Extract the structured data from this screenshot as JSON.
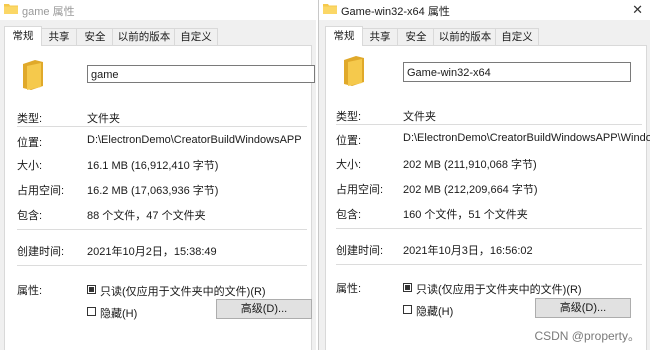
{
  "left": {
    "title": "game 属性",
    "tabs": [
      "常规",
      "共享",
      "安全",
      "以前的版本",
      "自定义"
    ],
    "name_value": "game",
    "type_label": "类型:",
    "type_value": "文件夹",
    "location_label": "位置:",
    "location_value": "D:\\ElectronDemo\\CreatorBuildWindowsAPP",
    "size_label": "大小:",
    "size_value": "16.1 MB (16,912,410 字节)",
    "disk_label": "占用空间:",
    "disk_value": "16.2 MB (17,063,936 字节)",
    "contains_label": "包含:",
    "contains_value": "88 个文件，47 个文件夹",
    "created_label": "创建时间:",
    "created_value": "2021年10月2日，15:38:49",
    "attr_label": "属性:",
    "readonly_label": "只读(仅应用于文件夹中的文件)(R)",
    "readonly_checked": true,
    "hidden_label": "隐藏(H)",
    "hidden_checked": false,
    "advanced_button": "高级(D)..."
  },
  "right": {
    "title": "Game-win32-x64 属性",
    "tabs": [
      "常规",
      "共享",
      "安全",
      "以前的版本",
      "自定义"
    ],
    "name_value": "Game-win32-x64",
    "type_label": "类型:",
    "type_value": "文件夹",
    "location_label": "位置:",
    "location_value": "D:\\ElectronDemo\\CreatorBuildWindowsAPP\\Windo",
    "size_label": "大小:",
    "size_value": "202 MB (211,910,068 字节)",
    "disk_label": "占用空间:",
    "disk_value": "202 MB (212,209,664 字节)",
    "contains_label": "包含:",
    "contains_value": "160 个文件，51 个文件夹",
    "created_label": "创建时间:",
    "created_value": "2021年10月3日，16:56:02",
    "attr_label": "属性:",
    "readonly_label": "只读(仅应用于文件夹中的文件)(R)",
    "readonly_checked": true,
    "hidden_label": "隐藏(H)",
    "hidden_checked": false,
    "advanced_button": "高级(D)..."
  },
  "watermark": "CSDN @property。",
  "colors": {
    "folder": "#f5c94c",
    "folder_dark": "#e0a92a",
    "panel": "#ffffff",
    "chrome": "#f0f0f0"
  },
  "icons": {
    "folder": "folder-icon",
    "close": "close-icon"
  }
}
